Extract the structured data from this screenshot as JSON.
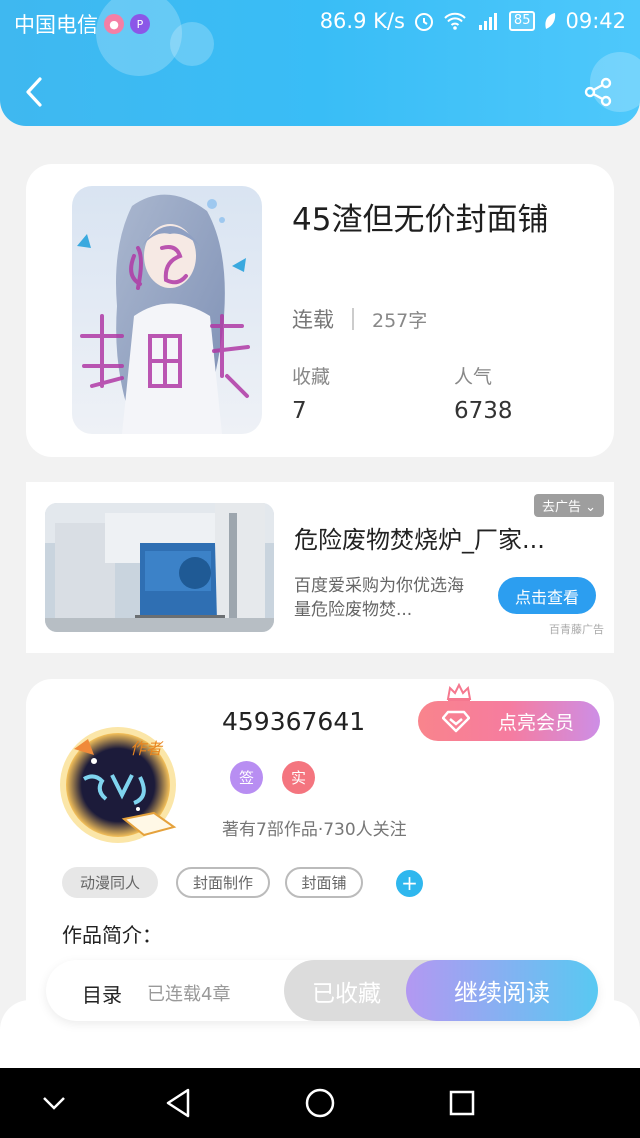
{
  "status_bar": {
    "carrier": "中国电信",
    "net_speed": "86.9 K/s",
    "battery": "85",
    "time": "09:42",
    "app_p_icon": "P"
  },
  "header": {
    "back_icon": "chevron-left-icon",
    "share_icon": "share-icon"
  },
  "book": {
    "title": "45渣但无价封面铺",
    "status": "连载",
    "word_count": "257字",
    "favorites_label": "收藏",
    "favorites_value": "7",
    "popularity_label": "人气",
    "popularity_value": "6738"
  },
  "ad": {
    "close_label": "去广告",
    "title": "危险废物焚烧炉_厂家...",
    "description": "百度爱采购为你优选海量危险废物焚...",
    "cta_label": "点击查看",
    "source": "百青藤广告"
  },
  "author": {
    "name": "459367641",
    "vip_label": "点亮会员",
    "badge_sign": "签",
    "badge_real": "实",
    "meta": "著有7部作品·730人关注",
    "tags": [
      "动漫同人",
      "封面制作",
      "封面铺"
    ],
    "add_tag": "+",
    "intro_label": "作品简介："
  },
  "actions": {
    "toc_label": "目录",
    "toc_count": "已连载4章",
    "collected_label": "已收藏",
    "read_label": "继续阅读"
  },
  "colors": {
    "header": "#3fb8f0",
    "accent": "#2fb7ee",
    "vip_start": "#f9848c",
    "vip_end": "#cd8ee6"
  }
}
